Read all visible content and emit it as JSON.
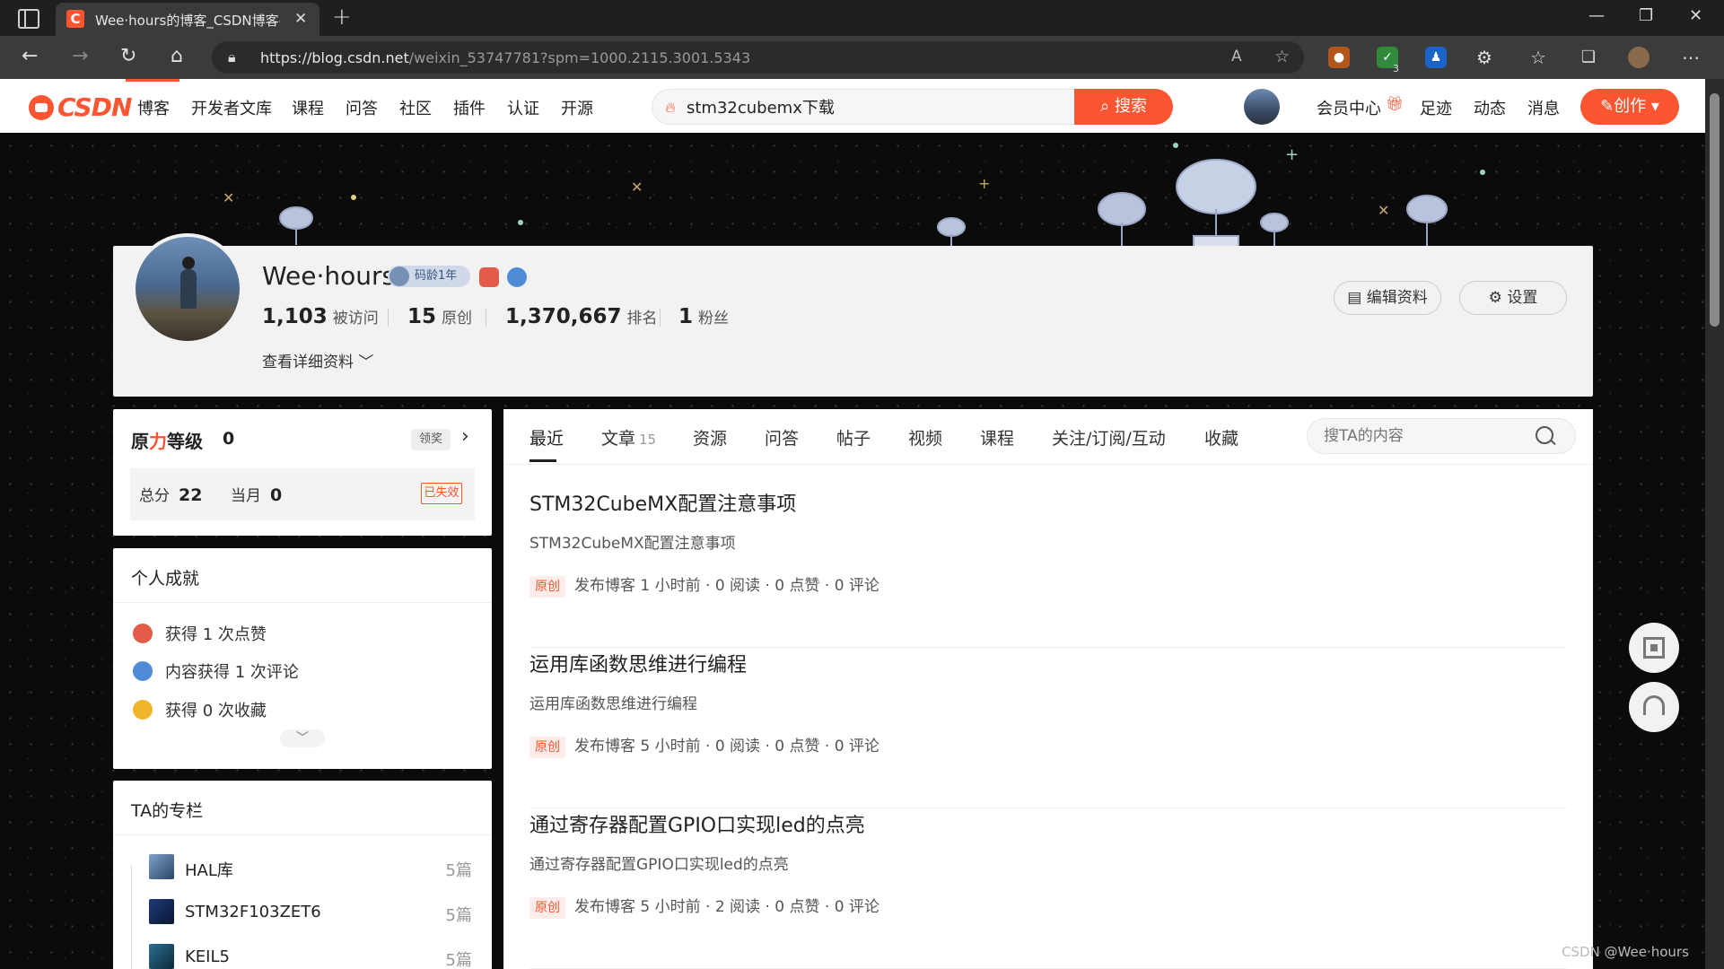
{
  "browser": {
    "tab_title": "Wee·hours的博客_CSDN博客-pyt",
    "url_host": "https://blog.csdn.net",
    "url_path": "/weixin_53747781?spm=1000.2115.3001.5343",
    "ext_badge_count": "3"
  },
  "csdn_nav": {
    "logo_text": "CSDN",
    "items": [
      "博客",
      "开发者文库",
      "课程",
      "问答",
      "社区",
      "插件",
      "认证",
      "开源"
    ],
    "search_value": "stm32cubemx下载",
    "search_button": "搜索",
    "right_items": [
      "会员中心",
      "足迹",
      "动态",
      "消息"
    ],
    "create_button": "创作"
  },
  "profile": {
    "name": "Wee·hours",
    "badge_age": "码龄1年",
    "stats": [
      {
        "num": "1,103",
        "label": "被访问"
      },
      {
        "num": "15",
        "label": "原创"
      },
      {
        "num": "1,370,667",
        "label": "排名"
      },
      {
        "num": "1",
        "label": "粉丝"
      }
    ],
    "more_info": "查看详细资料",
    "edit_button": "编辑资料",
    "settings_button": "设置"
  },
  "level": {
    "title_prefix": "原",
    "title_red": "力",
    "title_suffix": "等级",
    "value": "0",
    "claim_button": "领奖",
    "total_label": "总分",
    "total_value": "22",
    "month_label": "当月",
    "month_value": "0",
    "status": "已失效"
  },
  "achievements": {
    "title": "个人成就",
    "items": [
      "获得 1 次点赞",
      "内容获得 1 次评论",
      "获得 0 次收藏"
    ]
  },
  "columns": {
    "title": "TA的专栏",
    "items": [
      {
        "name": "HAL库",
        "count": "5篇"
      },
      {
        "name": "STM32F103ZET6",
        "count": "5篇"
      },
      {
        "name": "KEIL5",
        "count": "5篇"
      }
    ]
  },
  "content_tabs": {
    "items": [
      {
        "label": "最近",
        "count": ""
      },
      {
        "label": "文章",
        "count": "15"
      },
      {
        "label": "资源",
        "count": ""
      },
      {
        "label": "问答",
        "count": ""
      },
      {
        "label": "帖子",
        "count": ""
      },
      {
        "label": "视频",
        "count": ""
      },
      {
        "label": "课程",
        "count": ""
      },
      {
        "label": "关注/订阅/互动",
        "count": ""
      },
      {
        "label": "收藏",
        "count": ""
      }
    ],
    "search_placeholder": "搜TA的内容"
  },
  "posts": [
    {
      "title": "STM32CubeMX配置注意事项",
      "desc": "STM32CubeMX配置注意事项",
      "tag": "原创",
      "meta": "发布博客 1 小时前 · 0 阅读 · 0 点赞 · 0 评论"
    },
    {
      "title": "运用库函数思维进行编程",
      "desc": "运用库函数思维进行编程",
      "tag": "原创",
      "meta": "发布博客 5 小时前 · 0 阅读 · 0 点赞 · 0 评论"
    },
    {
      "title": "通过寄存器配置GPIO口实现led的点亮",
      "desc": "通过寄存器配置GPIO口实现led的点亮",
      "tag": "原创",
      "meta": "发布博客 5 小时前 · 2 阅读 · 0 点赞 · 0 评论"
    }
  ],
  "watermark": "CSDN @Wee·hours",
  "colors": {
    "brand": "#fc5531",
    "banner_bg": "#0b0b0b",
    "card_bg": "#f2f2f2"
  }
}
